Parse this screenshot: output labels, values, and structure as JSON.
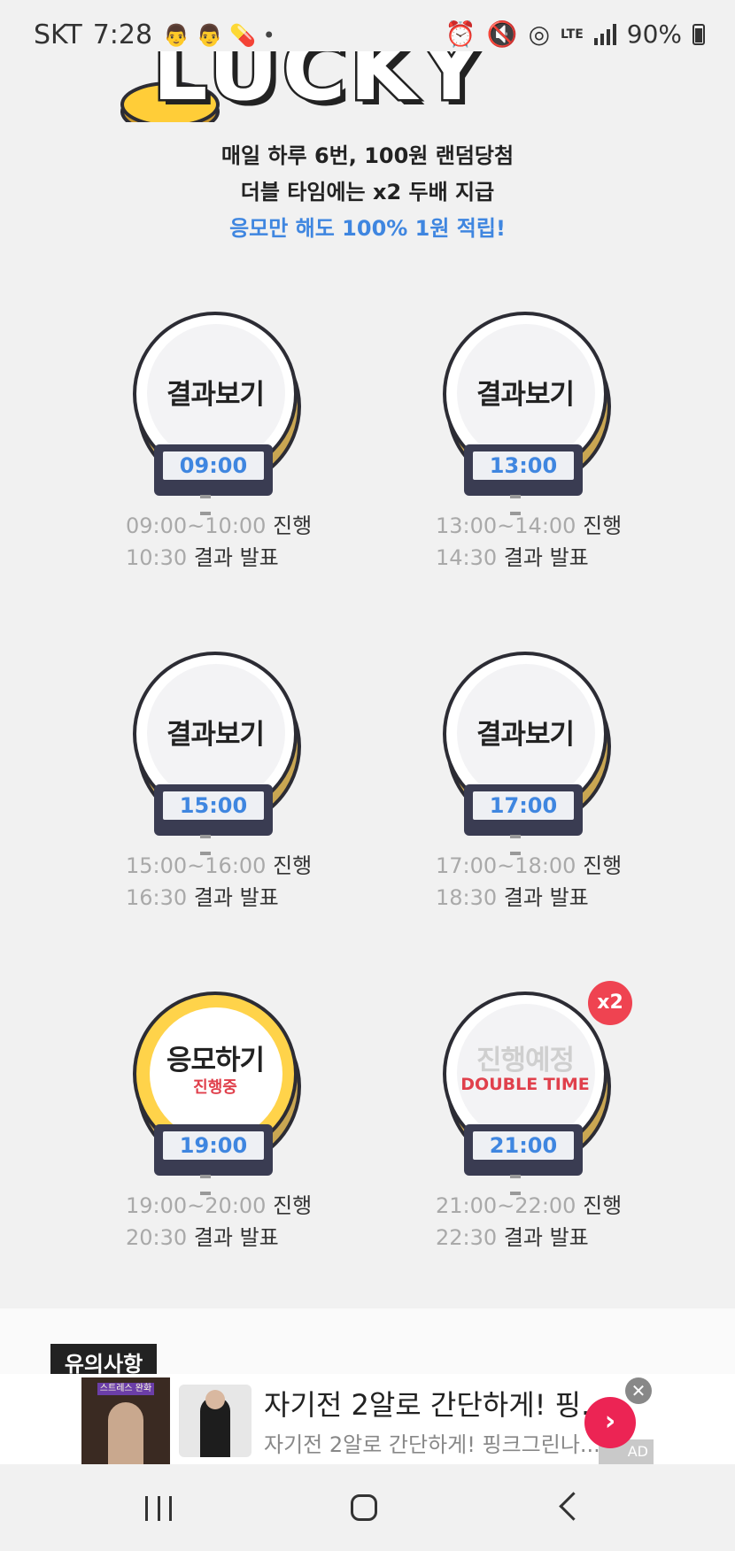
{
  "status_bar": {
    "carrier": "SKT",
    "time": "7:28",
    "notif_icons": "👨 👨 💊 •",
    "network": "LTE",
    "battery": "90%"
  },
  "header": {
    "title": "LUCKY TIME",
    "line1": "매일 하루 6번, 100원 랜덤당첨",
    "line2": "더블 타임에는 x2 두배 지급",
    "line3": "응모만 해도 100% 1원 적립!"
  },
  "slots": [
    {
      "button": "결과보기",
      "sub": "",
      "time": "09:00",
      "range": "09:00~10:00",
      "progress_label": "진행",
      "result_time": "10:30",
      "result_label": "결과 발표"
    },
    {
      "button": "결과보기",
      "sub": "",
      "time": "13:00",
      "range": "13:00~14:00",
      "progress_label": "진행",
      "result_time": "14:30",
      "result_label": "결과 발표"
    },
    {
      "button": "결과보기",
      "sub": "",
      "time": "15:00",
      "range": "15:00~16:00",
      "progress_label": "진행",
      "result_time": "16:30",
      "result_label": "결과 발표"
    },
    {
      "button": "결과보기",
      "sub": "",
      "time": "17:00",
      "range": "17:00~18:00",
      "progress_label": "진행",
      "result_time": "18:30",
      "result_label": "결과 발표"
    },
    {
      "button": "응모하기",
      "sub": "진행중",
      "time": "19:00",
      "range": "19:00~20:00",
      "progress_label": "진행",
      "result_time": "20:30",
      "result_label": "결과 발표"
    },
    {
      "button": "진행예정",
      "sub": "DOUBLE TIME",
      "badge": "x2",
      "time": "21:00",
      "range": "21:00~22:00",
      "progress_label": "진행",
      "result_time": "22:30",
      "result_label": "결과 발표"
    }
  ],
  "notice": {
    "tag": "유의사항"
  },
  "ad": {
    "title": "자기전 2알로 간단하게! 핑...",
    "subtitle": "자기전 2알로 간단하게! 핑크그린나...",
    "thumb_tag": "스트레스 완화",
    "ad_mark": "AD",
    "close_glyph": "✕",
    "go_glyph": "›"
  },
  "colors": {
    "accent_blue": "#3f86e0",
    "accent_red": "#ef4351",
    "coin_gold": "#ffd34a"
  }
}
